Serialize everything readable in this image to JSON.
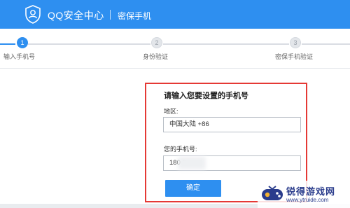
{
  "header": {
    "brand": "QQ安全中心",
    "subtitle": "密保手机"
  },
  "steps": [
    {
      "number": "1",
      "label": "输入手机号",
      "active": true
    },
    {
      "number": "2",
      "label": "身份验证",
      "active": false
    },
    {
      "number": "3",
      "label": "密保手机验证",
      "active": false
    }
  ],
  "form": {
    "title": "请输入您要设置的手机号",
    "region_label": "地区:",
    "region_value": "中国大陆 +86",
    "phone_label": "您的手机号:",
    "phone_value": "180        9",
    "submit_label": "确定"
  },
  "watermark": {
    "title": "锐得游戏网",
    "url": "www.ytruide.com"
  },
  "colors": {
    "brand_blue": "#2e8ff0",
    "highlight_red": "#e53935"
  }
}
